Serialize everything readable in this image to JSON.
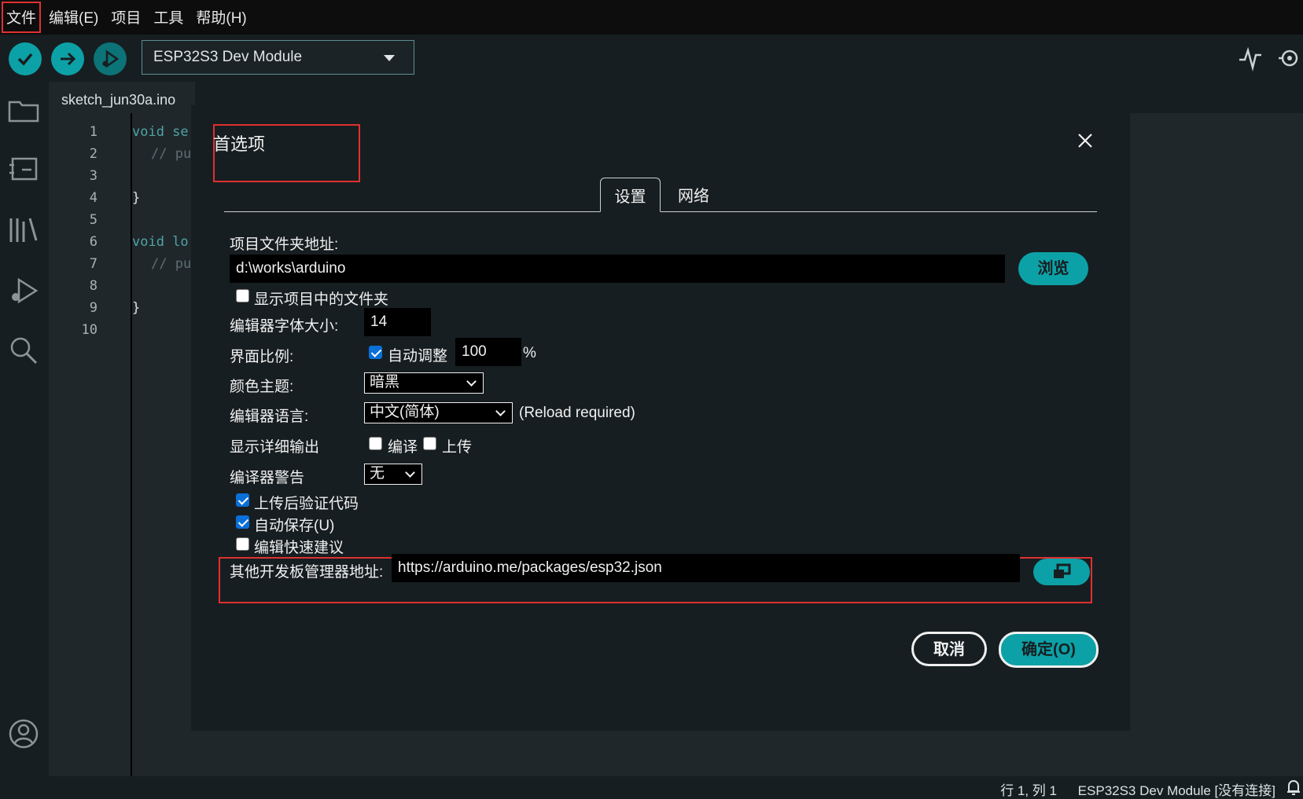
{
  "menu": {
    "items": [
      "文件",
      "编辑(E)",
      "项目",
      "工具",
      "帮助(H)"
    ]
  },
  "toolbar": {
    "board": "ESP32S3 Dev Module"
  },
  "editor": {
    "tab": "sketch_jun30a.ino",
    "line_numbers": [
      "1",
      "2",
      "3",
      "4",
      "5",
      "6",
      "7",
      "8",
      "9",
      "10"
    ],
    "code_fragments": {
      "l1": "void se",
      "l2": "// pu",
      "l4": "}",
      "l6": "void lo",
      "l7": "// pu",
      "l9": "}"
    }
  },
  "status": {
    "position": "行 1, 列 1",
    "board": "ESP32S3 Dev Module [没有连接]"
  },
  "dialog": {
    "title": "首选项",
    "tabs": [
      "设置",
      "网络"
    ],
    "sketchbook_label": "项目文件夹地址:",
    "sketchbook_value": "d:\\works\\arduino",
    "browse": "浏览",
    "show_files_label": "显示项目中的文件夹",
    "font_size_label": "编辑器字体大小:",
    "font_size_value": "14",
    "scale_label": "界面比例:",
    "auto_scale_label": "自动调整",
    "scale_value": "100",
    "scale_unit": "%",
    "theme_label": "颜色主题:",
    "theme_value": "暗黑",
    "language_label": "编辑器语言:",
    "language_value": "中文(简体)",
    "reload_note": "(Reload required)",
    "verbose_label": "显示详细输出",
    "verbose_compile": "编译",
    "verbose_upload": "上传",
    "warnings_label": "编译器警告",
    "warnings_value": "无",
    "verify_label": "上传后验证代码",
    "autosave_label": "自动保存(U)",
    "quick_suggest_label": "编辑快速建议",
    "urls_label": "其他开发板管理器地址:",
    "urls_value": "https://arduino.me/packages/esp32.json",
    "cancel": "取消",
    "ok": "确定(O)",
    "checkbox_states": {
      "show_files": false,
      "auto_scale": true,
      "verbose_compile": false,
      "verbose_upload": false,
      "verify": true,
      "autosave": true,
      "quick_suggest": false
    }
  },
  "colors": {
    "accent": "#0ca1a6",
    "highlight_box": "#e03030",
    "background": "#171e21"
  }
}
